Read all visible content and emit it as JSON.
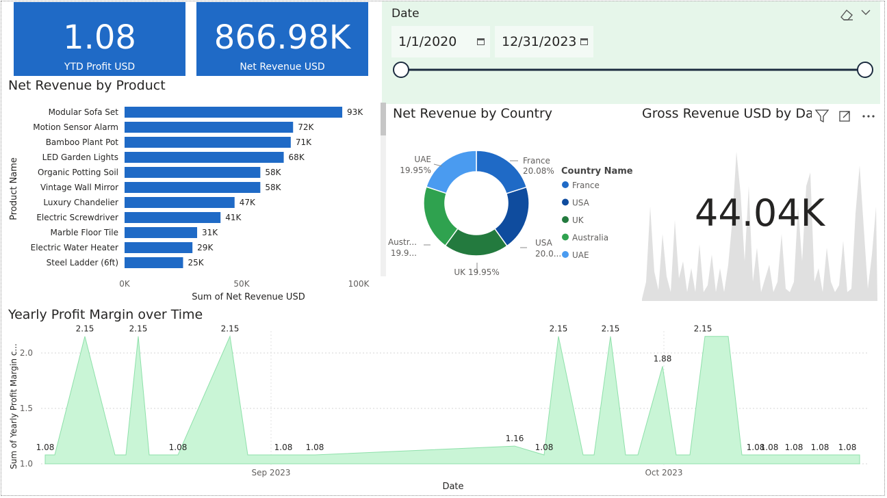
{
  "kpis": [
    {
      "value": "1.08",
      "label": "YTD Profit USD"
    },
    {
      "value": "866.98K",
      "label": "Net Revenue USD"
    }
  ],
  "date_slicer": {
    "title": "Date",
    "start": "1/1/2020",
    "end": "12/31/2023",
    "range_fraction": [
      0,
      1
    ]
  },
  "colors": {
    "accent_blue": "#1f6ac6",
    "slicer_bg": "#e6f6ea",
    "area_green": "#c9f5d6",
    "area_line": "#8ee0aa",
    "gray_area": "#e0e0e0"
  },
  "gross_card": {
    "title": "Gross Revenue USD by Da",
    "value": "44.04K",
    "icons": [
      "filter-icon",
      "focus-mode-icon",
      "more-options-icon"
    ]
  },
  "chart_data": [
    {
      "type": "bar",
      "title": "Net Revenue by Product",
      "xlabel": "Sum of Net Revenue USD",
      "ylabel": "Product Name",
      "xlim": [
        0,
        100000
      ],
      "xticks": [
        "0K",
        "50K",
        "100K"
      ],
      "categories": [
        "Modular Sofa Set",
        "Motion Sensor Alarm",
        "Bamboo Plant Pot",
        "LED Garden Lights",
        "Organic Potting Soil",
        "Vintage Wall Mirror",
        "Luxury Chandelier",
        "Electric Screwdriver",
        "Marble Floor Tile",
        "Electric Water Heater",
        "Steel Ladder (6ft)"
      ],
      "values": [
        93000,
        72000,
        71000,
        68000,
        58000,
        58000,
        47000,
        41000,
        31000,
        29000,
        25000
      ],
      "data_labels": [
        "93K",
        "72K",
        "71K",
        "68K",
        "58K",
        "58K",
        "47K",
        "41K",
        "31K",
        "29K",
        "25K"
      ]
    },
    {
      "type": "pie",
      "title": "Net Revenue by Country",
      "legend_title": "Country Name",
      "labels": [
        "France",
        "USA",
        "UK",
        "Australia",
        "UAE"
      ],
      "values": [
        20.08,
        20.0,
        19.95,
        20.0,
        19.95
      ],
      "data_labels": [
        "20.08%",
        "20.0...",
        "19.95%",
        "19.9...",
        "19.95%"
      ],
      "outer_labels": [
        "France",
        "USA",
        "UK",
        "Austr...",
        "UAE"
      ],
      "colors": [
        "#1f6ac6",
        "#0f4c9e",
        "#237a3e",
        "#2fa24f",
        "#4a9bf0"
      ]
    },
    {
      "type": "area",
      "title": "Yearly Profit Margin over Time",
      "xlabel": "Date",
      "ylabel": "Sum of Yearly Profit Margin c...",
      "ylim": [
        1.0,
        2.2
      ],
      "yticks": [
        1.0,
        1.5,
        2.0
      ],
      "xticks": [
        "Sep 2023",
        "Oct 2023"
      ],
      "x": [
        "Aug 18",
        "Aug 20",
        "Aug 22",
        "Aug 24",
        "Aug 26",
        "Aug 27",
        "Aug 29",
        "Aug 31",
        "Sep 3",
        "Sep 5",
        "Sep 7",
        "Sep 9",
        "Sep 10",
        "Sep 11",
        "Sep 13",
        "Sep 14",
        "Sep 15",
        "Sep 17",
        "Sep 23",
        "Sep 25",
        "Sep 26",
        "Sep 27",
        "Sep 29",
        "Sep 30",
        "Oct 1",
        "Oct 2",
        "Oct 3",
        "Oct 4",
        "Oct 5",
        "Oct 6",
        "Oct 7",
        "Oct 8",
        "Oct 9",
        "Oct 11",
        "Oct 13",
        "Oct 15",
        "Oct 18"
      ],
      "values": [
        1.08,
        1.08,
        2.15,
        1.08,
        1.08,
        2.15,
        1.08,
        1.08,
        1.08,
        2.15,
        1.08,
        1.08,
        1.08,
        1.08,
        1.08,
        1.08,
        1.16,
        1.08,
        2.15,
        1.08,
        1.08,
        2.15,
        1.08,
        1.08,
        1.88,
        1.08,
        1.08,
        2.15,
        2.15,
        2.15,
        1.08,
        1.08,
        1.08,
        1.08,
        1.08,
        1.08,
        1.08
      ],
      "labeled": [
        "1.08",
        "2.15",
        "2.15",
        "1.08",
        "2.15",
        "1.08",
        "1.08",
        "1.16",
        "1.08",
        "2.15",
        "2.15",
        "1.88",
        "2.15",
        "1.08",
        "1.08",
        "1.08",
        "1.08",
        "1.08"
      ]
    }
  ]
}
